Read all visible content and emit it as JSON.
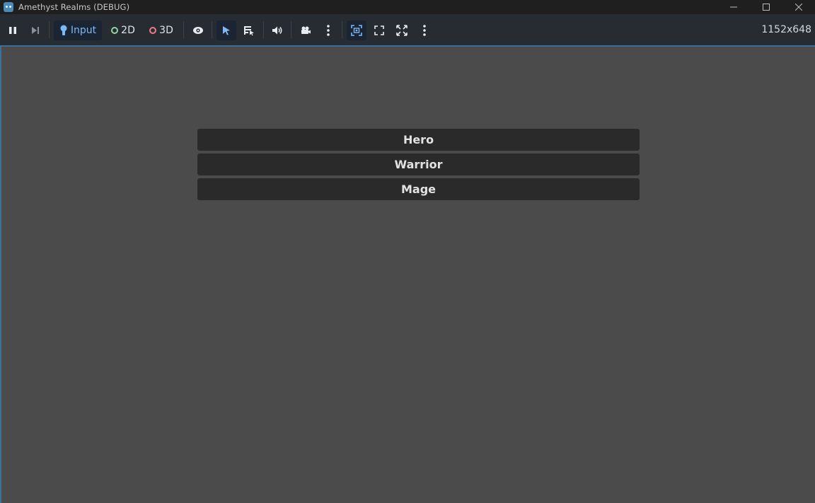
{
  "window": {
    "title": "Amethyst Realms (DEBUG)",
    "icon": "godot-icon",
    "controls": [
      "minimize-icon",
      "maximize-icon",
      "close-icon"
    ]
  },
  "toolbar": {
    "pause_icon": "pause-icon",
    "step_icon": "next-frame-icon",
    "input_label": "Input",
    "mode_2d_label": "2D",
    "mode_3d_label": "3D",
    "tools": [
      "eye-icon",
      "select-arrow-icon",
      "list-select-icon",
      "speaker-icon",
      "camera-icon",
      "more-vertical-icon",
      "focus-frame-icon",
      "expand-icon",
      "fullscreen-icon",
      "more-vertical-icon"
    ],
    "resolution": "1152x648"
  },
  "menu": {
    "buttons": [
      "Hero",
      "Warrior",
      "Mage"
    ]
  },
  "colors": {
    "toolbar_bg": "#272c33",
    "viewport_bg": "#4b4b4b",
    "button_bg": "#2a2a2a",
    "accent": "#7cb8f5"
  }
}
